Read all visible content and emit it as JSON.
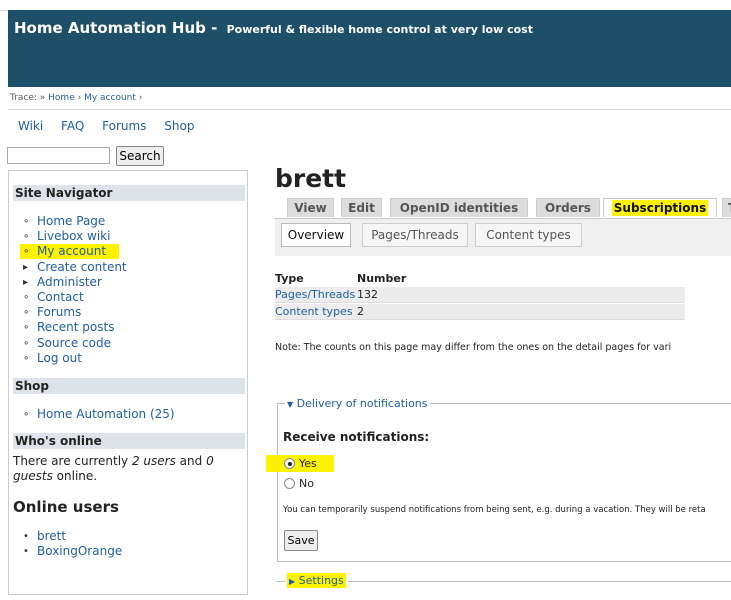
{
  "header": {
    "site_name": "Home Automation Hub -",
    "slogan": "Powerful & flexible home control at very low cost"
  },
  "breadcrumb": {
    "prefix": "Trace: »",
    "items": [
      "Home",
      "My account"
    ],
    "sep": "›"
  },
  "primary_links": [
    "Wiki",
    "FAQ",
    "Forums",
    "Shop"
  ],
  "search": {
    "button": "Search",
    "value": ""
  },
  "site_navigator": {
    "title": "Site Navigator",
    "items": [
      {
        "label": "Home Page",
        "bullet": "∘"
      },
      {
        "label": "Livebox wiki",
        "bullet": "∘"
      },
      {
        "label": "My account",
        "bullet": "∘"
      },
      {
        "label": "Create content",
        "bullet": "▸"
      },
      {
        "label": "Administer",
        "bullet": "▸"
      },
      {
        "label": "Contact",
        "bullet": "∘"
      },
      {
        "label": "Forums",
        "bullet": "∘"
      },
      {
        "label": "Recent posts",
        "bullet": "∘"
      },
      {
        "label": "Source code",
        "bullet": "∘"
      },
      {
        "label": "Log out",
        "bullet": "∘"
      }
    ]
  },
  "shop_block": {
    "title": "Shop",
    "items": [
      "Home Automation (25)"
    ]
  },
  "whos_online": {
    "title": "Who's online",
    "text_a": "There are currently",
    "users": "2 users",
    "and": "and",
    "guests_num": "0",
    "guests": "guests",
    "online": "online."
  },
  "online_users": {
    "title": "Online users",
    "items": [
      "brett",
      "BoxingOrange"
    ]
  },
  "profile": {
    "username": "brett"
  },
  "tabs": [
    "View",
    "Edit",
    "OpenID identities",
    "Orders",
    "Subscriptions",
    "T"
  ],
  "subtabs": [
    "Overview",
    "Pages/Threads",
    "Content types"
  ],
  "stats": {
    "headers": [
      "Type",
      "Number"
    ],
    "rows": [
      {
        "type": "Pages/Threads",
        "number": "132"
      },
      {
        "type": "Content types",
        "number": "2"
      }
    ]
  },
  "note": "Note: The counts on this page may differ from the ones on the detail pages for vari",
  "delivery": {
    "legend": "Delivery of notifications",
    "receive_label": "Receive notifications:",
    "options": [
      "Yes",
      "No"
    ],
    "selected": "Yes",
    "description": "You can temporarily suspend notifications from being sent, e.g. during a vacation. They will be reta",
    "save": "Save"
  },
  "settings": {
    "legend": "Settings"
  },
  "colors": {
    "header_bg": "#1d5068",
    "link": "#1f5f9e",
    "highlight": "#fff200"
  }
}
